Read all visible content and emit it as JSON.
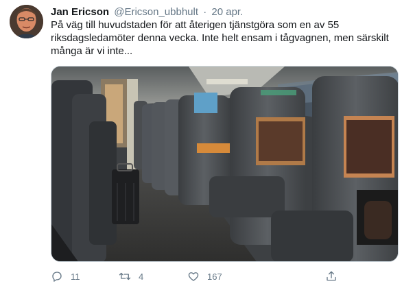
{
  "tweet": {
    "author_name": "Jan Ericson",
    "handle": "@Ericson_ubbhult",
    "separator": "·",
    "date": "20 apr.",
    "text": "På väg till huvudstaden för att återigen tjänstgöra som en av 55\nriksdagsledamöter denna vecka. Inte helt ensam i tågvagnen, men särskilt\nmånga är vi inte..."
  },
  "actions": {
    "reply_count": "11",
    "retweet_count": "4",
    "like_count": "167"
  },
  "icons": {
    "reply": "comment-icon",
    "retweet": "retweet-icon",
    "like": "heart-icon",
    "share": "share-icon"
  },
  "colors": {
    "text": "#14171a",
    "secondary": "#657786",
    "border": "#ccd6dd"
  }
}
